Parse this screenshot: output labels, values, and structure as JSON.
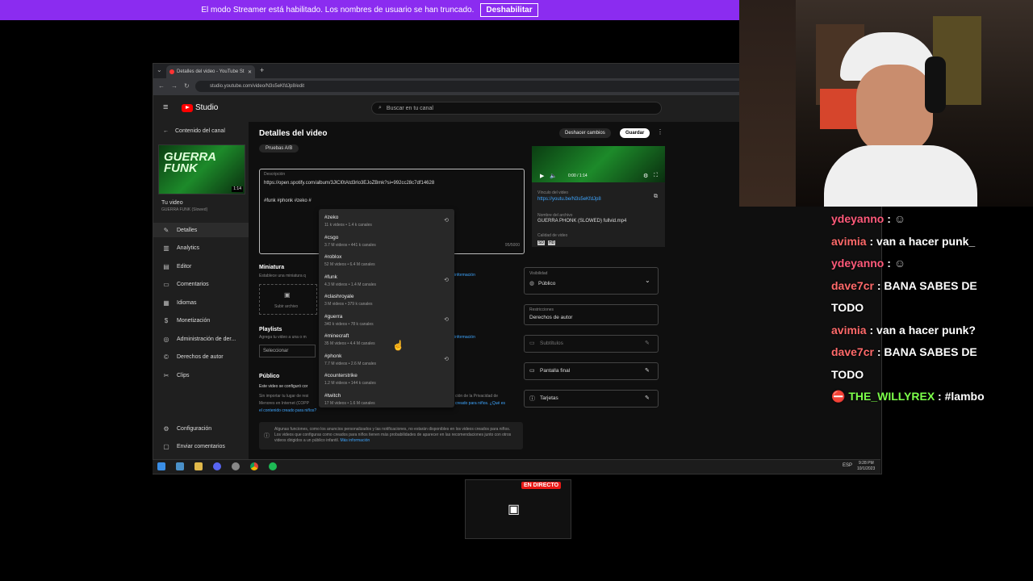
{
  "banner": {
    "message": "El modo Streamer está habilitado. Los nombres de usuario se han truncado.",
    "button": "Deshabilitar"
  },
  "browser": {
    "tab_title": "Detalles del video - YouTube St",
    "url": "studio.youtube.com/video/N3s5eKfdJp8/edit"
  },
  "studio": {
    "logo": "Studio",
    "search_placeholder": "Buscar en tu canal",
    "back_label": "Contenido del canal",
    "video_label": "Tu video",
    "video_title": "GUERRA FUNK (Slowed)",
    "thumb_text": "GUERRA FUNK",
    "thumb_duration": "1:14",
    "nav": [
      {
        "icon": "pencil-icon",
        "label": "Detalles"
      },
      {
        "icon": "analytics-icon",
        "label": "Analytics"
      },
      {
        "icon": "editor-icon",
        "label": "Editor"
      },
      {
        "icon": "comments-icon",
        "label": "Comentarios"
      },
      {
        "icon": "languages-icon",
        "label": "Idiomas"
      },
      {
        "icon": "dollar-icon",
        "label": "Monetización"
      },
      {
        "icon": "rights-icon",
        "label": "Administración de der..."
      },
      {
        "icon": "copyright-icon",
        "label": "Derechos de autor"
      },
      {
        "icon": "clips-icon",
        "label": "Clips"
      }
    ],
    "settings": "Configuración",
    "feedback": "Enviar comentarios",
    "page_title": "Detalles del video",
    "undo": "Deshacer cambios",
    "save": "Guardar",
    "ab_test": "Pruebas A/B",
    "desc_label": "Descripción",
    "desc_url": "https://open.spotify.com/album/3JlCl0tAtd3rlo3EJoZBmk?si=992cc28c7df14628",
    "desc_tags": "#funk #phonk #zeko #",
    "desc_counter": "95/5000",
    "thumbnail_heading": "Miniatura",
    "thumbnail_sub": "Establece una miniatura q",
    "more_info": "información",
    "upload_file": "Subir archivo",
    "playlists_heading": "Playlists",
    "playlists_sub": "Agrega tu video a una o m",
    "select_label": "Seleccionar",
    "audience_heading": "Público",
    "audience_line1": "Este video se configuró cor",
    "audience_line2": "Sin importar tu lugar de resi",
    "audience_line3": "Menores en Internet (COPP",
    "audience_line4": "el contenido creado para niños?",
    "audience_right": "ción de la Privacidad de",
    "audience_right2": "creado para niños. ¿Qué es",
    "notice": "Algunas funciones, como los anuncios personalizados y las notificaciones, no estarán disponibles en los videos creados para niños. Los videos que configuras como creados para niños tienen más probabilidades de aparecer en las recomendaciones junto con otros videos dirigidos a un público infantil.",
    "notice_link": "Más información",
    "video_time": "0:00 / 1:14",
    "video_link_label": "Vínculo del video",
    "video_link": "https://youtu.be/N3s5eKfdJp8",
    "file_label": "Nombre del archivo",
    "file_name": "GUERRA PHONK (SLOWED) fullvid.mp4",
    "quality_label": "Calidad de video",
    "quality_sd": "SD",
    "quality_hd": "HD",
    "visibility_label": "Visibilidad",
    "visibility_value": "Público",
    "restrictions_label": "Restricciones",
    "restrictions_value": "Derechos de autor",
    "subtitles": "Subtítulos",
    "end_screen": "Pantalla final",
    "cards": "Tarjetas",
    "suggestions": [
      {
        "tag": "#zeko",
        "meta": "11 k videos • 1.4 k canales",
        "history": true
      },
      {
        "tag": "#csgo",
        "meta": "3.7 M videos • 441 k canales",
        "history": false
      },
      {
        "tag": "#roblox",
        "meta": "52 M videos • 6.4 M canales",
        "history": false
      },
      {
        "tag": "#funk",
        "meta": "4.3 M videos • 1.4 M canales",
        "history": true
      },
      {
        "tag": "#clashroyale",
        "meta": "3 M videos • 379 k canales",
        "history": false
      },
      {
        "tag": "#guerra",
        "meta": "340 k videos • 78 k canales",
        "history": true
      },
      {
        "tag": "#minecraft",
        "meta": "35 M videos • 4.4 M canales",
        "history": false
      },
      {
        "tag": "#phonk",
        "meta": "7.7 M videos • 2.6 M canales",
        "history": true
      },
      {
        "tag": "#counterstrike",
        "meta": "1.2 M videos • 144 k canales",
        "history": false
      },
      {
        "tag": "#twitch",
        "meta": "17 M videos • 1.6 M canales",
        "history": false
      }
    ]
  },
  "taskbar": {
    "lang": "ESP",
    "time": "9:28 PM",
    "date": "10/1/2023"
  },
  "chat": [
    {
      "user": "ydeyanno",
      "text": ""
    },
    {
      "user": "avimia",
      "text": "van a hacer punk_"
    },
    {
      "user": "ydeyanno",
      "text": ""
    },
    {
      "user": "dave7cr",
      "text": "BANA SABES DE"
    },
    {
      "user": "",
      "text": "TODO"
    },
    {
      "user": "avimia",
      "text": "van a hacer punk?"
    },
    {
      "user": "dave7cr",
      "text": "BANA SABES DE"
    },
    {
      "user": "",
      "text": "TODO"
    },
    {
      "user": "THE_WILLYREX",
      "text": "#lambo"
    }
  ],
  "live_badge": "EN DIRECTO",
  "colors": {
    "banner": "#8b2cf0",
    "ydeyanno": "#ff5a7a",
    "avimia": "#ff6a6a",
    "dave7cr": "#ff6a6a",
    "willyrex": "#7cff4a",
    "link": "#3ea6ff",
    "live": "#e91916"
  }
}
